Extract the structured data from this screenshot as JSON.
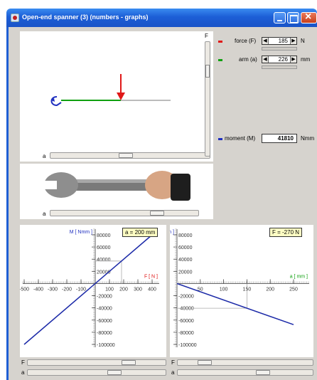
{
  "window": {
    "title": "Open-end spanner (3) (numbers - graphs)"
  },
  "sliders": {
    "top_vertical_label": "F",
    "top_horizontal_label": "a",
    "photo_label": "a",
    "bottom_f_label": "F",
    "bottom_a_label": "a"
  },
  "controls": {
    "force_label": "force (F)",
    "force_value": "185",
    "force_unit": "N",
    "arm_label": "arm (a)",
    "arm_value": "226",
    "arm_unit": "mm",
    "moment_label": "moment (M)",
    "moment_value": "41810",
    "moment_unit": "Nmm",
    "colors": {
      "force": "#e01818",
      "arm": "#10a010",
      "moment": "#2030c0"
    }
  },
  "graph_left": {
    "badge": "a = 200 mm",
    "y_label": "M [ Nmm ]",
    "x_label": "F [ N ]",
    "y_ticks": [
      "80000",
      "60000",
      "40000",
      "20000",
      "-20000",
      "-40000",
      "-60000",
      "-80000",
      "-100000"
    ],
    "x_ticks": [
      "-500",
      "-400",
      "-300",
      "-200",
      "-100",
      "100",
      "200",
      "300",
      "400"
    ]
  },
  "graph_right": {
    "badge": "F = -270 N",
    "y_label": "M [ Nmm ]",
    "x_label": "a [ mm ]",
    "y_ticks": [
      "80000",
      "60000",
      "40000",
      "20000",
      "-20000",
      "-40000",
      "-60000",
      "-80000",
      "-100000"
    ],
    "x_ticks": [
      "50",
      "100",
      "150",
      "200",
      "250"
    ]
  },
  "chart_data": [
    {
      "type": "line",
      "title": "",
      "xlabel": "F [ N ]",
      "ylabel": "M [ Nmm ]",
      "xlim": [
        -500,
        400
      ],
      "ylim": [
        -100000,
        80000
      ],
      "series": [
        {
          "x": [
            -500,
            400
          ],
          "y": [
            -100000,
            80000
          ]
        }
      ],
      "marker": {
        "x": 185,
        "y": 37000
      }
    },
    {
      "type": "line",
      "title": "",
      "xlabel": "a [ mm ]",
      "ylabel": "M [ Nmm ]",
      "xlim": [
        0,
        250
      ],
      "ylim": [
        -100000,
        80000
      ],
      "series": [
        {
          "x": [
            0,
            250
          ],
          "y": [
            0,
            -67500
          ]
        }
      ],
      "marker": {
        "x": 150,
        "y": -40500
      }
    }
  ]
}
